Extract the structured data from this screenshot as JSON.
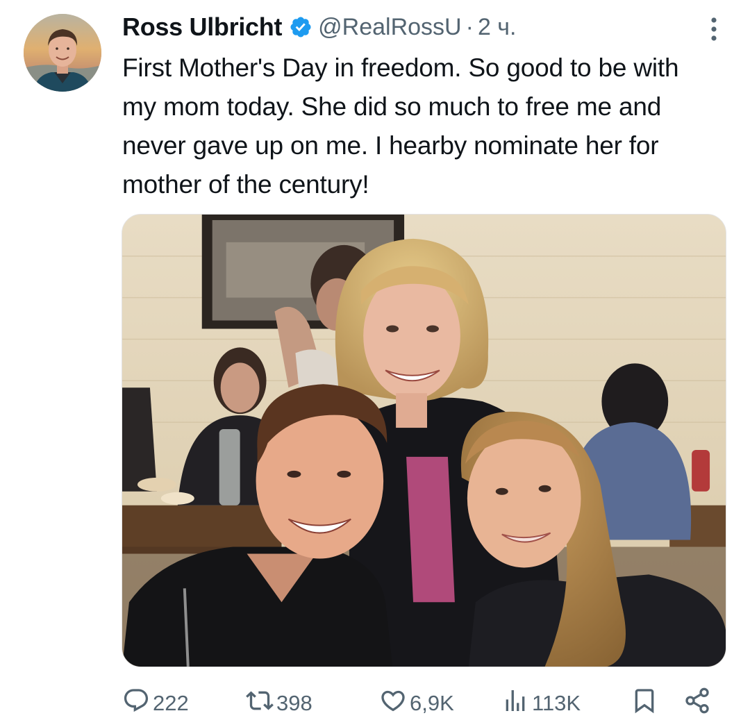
{
  "author": {
    "name": "Ross Ulbricht",
    "handle": "@RealRossU",
    "separator": "·",
    "time": "2 ч."
  },
  "tweet": {
    "text": "First Mother's Day in freedom. So good to be with my mom today. She did so much to free me and never gave up on me. I hearby nominate her for mother of the century!"
  },
  "actions": {
    "replies": "222",
    "retweets": "398",
    "likes": "6,9K",
    "views": "113K"
  },
  "icons": {
    "verified": "verified-badge-icon",
    "more": "more-vertical-icon",
    "reply": "reply-icon",
    "retweet": "retweet-icon",
    "like": "heart-icon",
    "views": "views-chart-icon",
    "bookmark": "bookmark-icon",
    "share": "share-icon"
  },
  "colors": {
    "verified": "#1d9bf0",
    "secondary_text": "#536471",
    "primary_text": "#0f1419"
  }
}
